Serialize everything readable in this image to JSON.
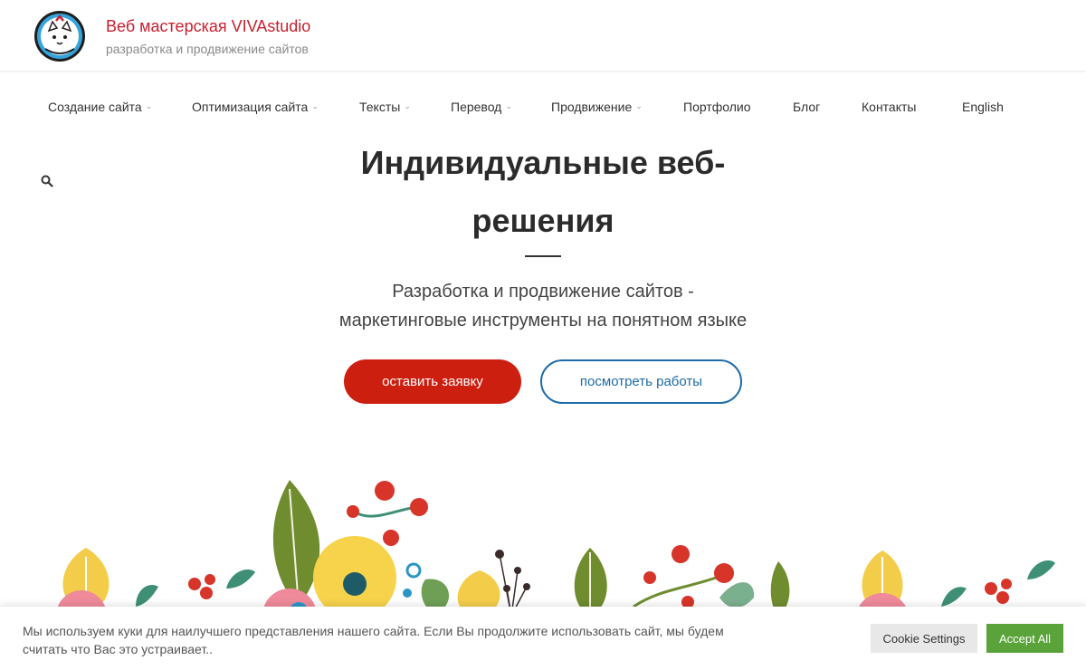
{
  "header": {
    "site_title": "Веб мастерская VIVAstudio",
    "tagline": "разработка и продвижение сайтов",
    "logo_icon": "cat-logo-icon"
  },
  "nav": {
    "items": [
      {
        "label": "Создание сайта",
        "has_submenu": true
      },
      {
        "label": "Оптимизация сайта",
        "has_submenu": true
      },
      {
        "label": "Тексты",
        "has_submenu": true
      },
      {
        "label": "Перевод",
        "has_submenu": true
      },
      {
        "label": "Продвижение",
        "has_submenu": true
      },
      {
        "label": "Портфолио",
        "has_submenu": false
      },
      {
        "label": "Блог",
        "has_submenu": false
      },
      {
        "label": "Контакты",
        "has_submenu": false
      },
      {
        "label": "English",
        "has_submenu": false
      }
    ],
    "caret": "⌄",
    "search_icon": "search-icon"
  },
  "hero": {
    "title_line1": "Индивидуальные веб-",
    "title_line2": "решения",
    "subtitle_line1": "Разработка и продвижение сайтов -",
    "subtitle_line2": "маркетинговые инструменты на понятном языке",
    "primary_button": "оставить заявку",
    "secondary_button": "посмотреть работы"
  },
  "cookie": {
    "text": "Мы используем куки для наилучшего представления нашего сайта. Если Вы продолжите использовать сайт, мы будем считать что Вас это устраивает..",
    "settings_label": "Cookie Settings",
    "accept_label": "Accept All"
  },
  "colors": {
    "brand_red": "#c8202e",
    "button_red": "#cc1f0f",
    "outline_blue": "#1d6ba8",
    "accept_green": "#5aa33a"
  }
}
